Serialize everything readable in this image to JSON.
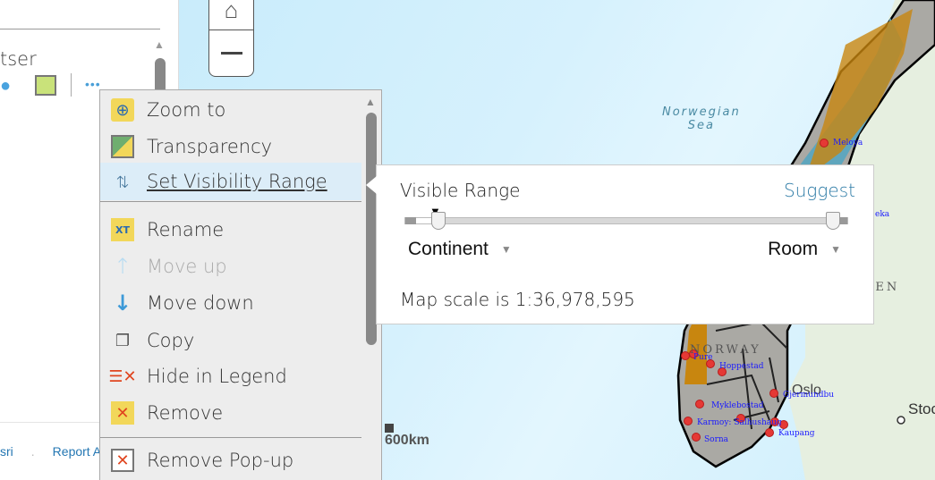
{
  "left_panel": {
    "layer_name_fragment": "tser",
    "footer_links": [
      "sri",
      ".",
      "Report A"
    ],
    "more_label": "•••"
  },
  "map": {
    "scale_bar_label": "600km",
    "labels": {
      "sea_line1": "Norwegian",
      "sea_line2": "Sea",
      "country_norway": "NORWAY",
      "country_sweden": "DEN",
      "city_oslo": "Oslo",
      "city_stockholm": "Stoc"
    },
    "places": [
      "Meloya",
      "eka",
      "Pure",
      "Hoppestad",
      "Gjermundbu",
      "Myklebostad",
      "Karmoy: Salhushaug",
      "Sorna",
      "Kaupang"
    ]
  },
  "context_menu": {
    "items": [
      {
        "label": "Zoom to",
        "icon": "zoom-to-icon"
      },
      {
        "label": "Transparency",
        "icon": "transparency-icon"
      },
      {
        "label": "Set Visibility Range",
        "icon": "visibility-range-icon",
        "active": true
      },
      {
        "label": "Rename",
        "icon": "rename-icon"
      },
      {
        "label": "Move up",
        "icon": "arrow-up-icon",
        "disabled": true
      },
      {
        "label": "Move down",
        "icon": "arrow-down-icon"
      },
      {
        "label": "Copy",
        "icon": "copy-icon"
      },
      {
        "label": "Hide in Legend",
        "icon": "hide-legend-icon"
      },
      {
        "label": "Remove",
        "icon": "remove-icon"
      },
      {
        "label": "Remove Pop-up",
        "icon": "remove-popup-icon"
      }
    ]
  },
  "visibility_popup": {
    "title": "Visible Range",
    "suggest": "Suggest",
    "min_scale": "Continent",
    "max_scale": "Room",
    "map_scale_text": "Map scale is 1:36,978,595",
    "accent": "#2d7ba6"
  }
}
